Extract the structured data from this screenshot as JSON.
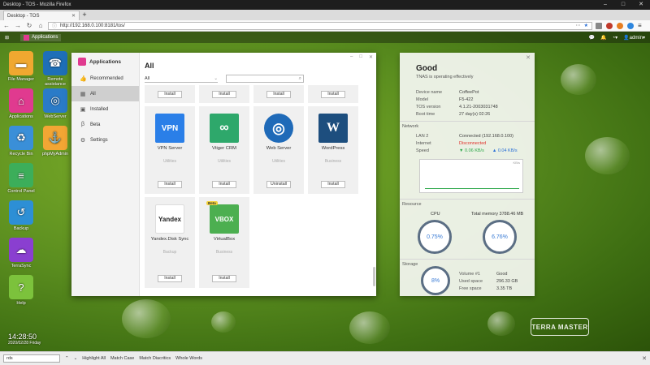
{
  "browser": {
    "window_title": "Desktop - TOS - Mozilla Firefox",
    "tab_title": "Desktop - TOS",
    "url": "http://192.168.0.100:8181/tos/",
    "new_tab": "+",
    "find": {
      "query": "rds",
      "highlight_all": "Highlight All",
      "match_case": "Match Case",
      "match_diacritics": "Match Diacritics",
      "whole_words": "Whole Words"
    }
  },
  "taskbar": {
    "applications_label": "Applications",
    "user_label": "admin"
  },
  "desktop_icons": [
    {
      "label": "File Manager",
      "color": "#f0a830",
      "glyph": "▬"
    },
    {
      "label": "Remote assistance",
      "color": "#1e6fb8",
      "glyph": "☎"
    },
    {
      "label": "Applications",
      "color": "#e03a8f",
      "glyph": "⌂"
    },
    {
      "label": "WebServer",
      "color": "#2a7bc8",
      "glyph": "◎"
    },
    {
      "label": "Recycle Bin",
      "color": "#3a8fd8",
      "glyph": "♻"
    },
    {
      "label": "phpMyAdmin",
      "color": "#f3a634",
      "glyph": "⚓"
    },
    {
      "label": "Control Panel",
      "color": "#3cae5a",
      "glyph": "≡"
    },
    {
      "label": "Backup",
      "color": "#2d8fd5",
      "glyph": "↺"
    },
    {
      "label": "TerraSync",
      "color": "#8a3fd0",
      "glyph": "☁"
    },
    {
      "label": "Help",
      "color": "#7cc23c",
      "glyph": "?"
    }
  ],
  "clock": {
    "time": "14:28:50",
    "date": "2020/02/28 Friday"
  },
  "app_window": {
    "title": "Applications",
    "sidebar": [
      {
        "label": "Recommended",
        "icon": "thumbs-up"
      },
      {
        "label": "All",
        "icon": "grid"
      },
      {
        "label": "Installed",
        "icon": "box"
      },
      {
        "label": "Beta",
        "icon": "beta"
      },
      {
        "label": "Settings",
        "icon": "gear"
      }
    ],
    "heading": "All",
    "filter_value": "All",
    "cards_top_row_buttons": [
      "Install",
      "Install",
      "Install",
      "Install"
    ],
    "cards": [
      {
        "name": "VPN Server",
        "category": "Utilities",
        "button": "Install",
        "logo_text": "VPN",
        "color": "#2a7fe8"
      },
      {
        "name": "Vtiger CRM",
        "category": "Utilities",
        "button": "Install",
        "logo_text": "∞",
        "color": "#2ea86b"
      },
      {
        "name": "Web Server",
        "category": "Utilities",
        "button": "Uninstall",
        "logo_text": "◎",
        "color": "#1f6ab8"
      },
      {
        "name": "WordPress",
        "category": "Business",
        "button": "Install",
        "logo_text": "W",
        "color": "#1d4e7e"
      },
      {
        "name": "Yandex.Disk Sync",
        "category": "Backup",
        "button": "Install",
        "logo_text": "Yandex",
        "color": "#ffffff"
      },
      {
        "name": "VirtualBox",
        "category": "Business",
        "button": "Install",
        "logo_text": "VBOX",
        "color": "#4caf50",
        "badge": "Beta"
      }
    ]
  },
  "status_panel": {
    "state": "Good",
    "state_detail": "TNAS is operating effectively",
    "info": [
      {
        "k": "Device name",
        "v": "CoffeePot"
      },
      {
        "k": "Model",
        "v": "F5-422"
      },
      {
        "k": "TOS version",
        "v": "4.1.21-2003031748"
      },
      {
        "k": "Boot time",
        "v": "27 day(s) 02:26"
      }
    ],
    "network_label": "Network",
    "network": [
      {
        "k": "LAN 2",
        "v": "Connected (192.168.0.100)"
      },
      {
        "k": "Internet",
        "v": "Disconnected"
      },
      {
        "k": "Speed",
        "down": "0.06 KB/s",
        "up": "0.04 KB/s"
      }
    ],
    "speed_chart_unit": "KB/s",
    "resource_label": "Resource",
    "cpu_label": "CPU",
    "cpu_value": "0.75%",
    "memory_label": "Total memory 3788.46 MB",
    "memory_value": "6.76%",
    "storage_label": "Storage",
    "storage_value": "8%",
    "storage": [
      {
        "k": "Volume #1",
        "v": "Good"
      },
      {
        "k": "Used space",
        "v": "296.33 GB"
      },
      {
        "k": "Free space",
        "v": "3.35 TB"
      }
    ]
  },
  "brand": "TERRA MASTER"
}
